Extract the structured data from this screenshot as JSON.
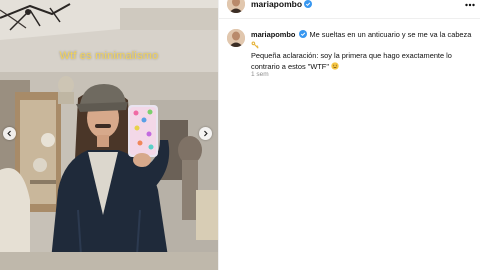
{
  "media": {
    "caption": "Wtf es minimalismo"
  },
  "post": {
    "username": "mariapombo",
    "comment": {
      "username": "mariapombo",
      "line1": "Me sueltas en un anticuario y se me va la cabeza",
      "line2": "Pequeña aclaración: soy la primera que hago exactamente lo contrario a estos \"WTF\"",
      "timestamp": "1 sem"
    }
  },
  "icons": {
    "verified": "verified-badge-icon",
    "more": "more-options-icon",
    "key_emoji": "key-emoji-icon",
    "smile_emoji": "smile-emoji-icon",
    "prev": "chevron-left-icon",
    "next": "chevron-right-icon"
  },
  "colors": {
    "verified_blue": "#3897f0",
    "caption_yellow": "#f2d35a",
    "meta_gray": "#8e8e8e"
  }
}
